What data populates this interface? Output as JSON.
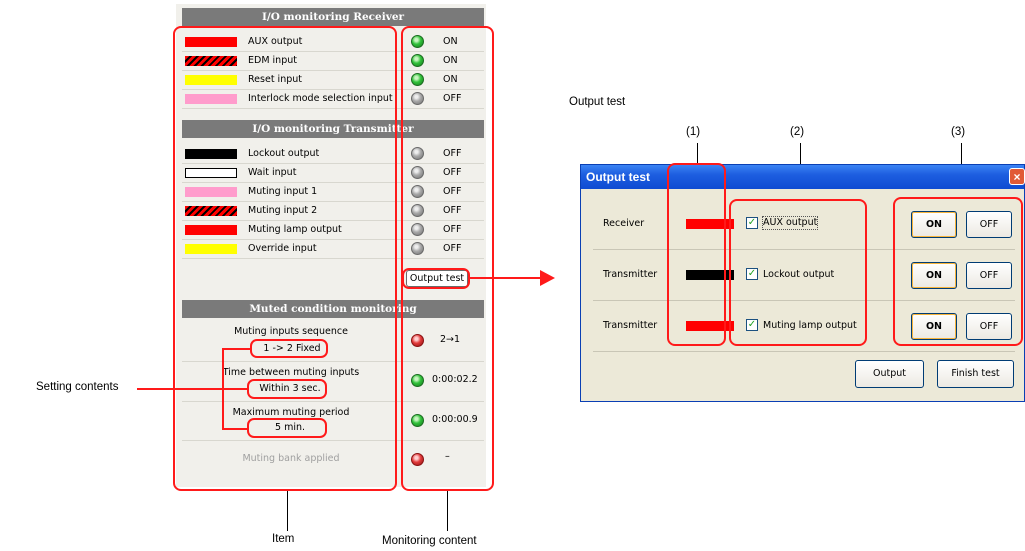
{
  "annotations": {
    "setting_contents": "Setting contents",
    "item": "Item",
    "monitoring_content": "Monitoring content",
    "output_test_caption": "Output test",
    "col_marker_1": "(1)",
    "col_marker_2": "(2)",
    "col_marker_3": "(3)"
  },
  "receiver": {
    "title": "I/O monitoring Receiver",
    "rows": [
      {
        "swatch": "red",
        "label": "AUX output",
        "led": "green",
        "state": "ON"
      },
      {
        "swatch": "red-black-hatch",
        "label": "EDM input",
        "led": "green",
        "state": "ON"
      },
      {
        "swatch": "yellow",
        "label": "Reset input",
        "led": "green",
        "state": "ON"
      },
      {
        "swatch": "pink",
        "label": "Interlock mode selection input",
        "led": "gray",
        "state": "OFF"
      }
    ]
  },
  "transmitter": {
    "title": "I/O monitoring Transmitter",
    "rows": [
      {
        "swatch": "black",
        "label": "Lockout output",
        "led": "gray",
        "state": "OFF"
      },
      {
        "swatch": "white",
        "label": "Wait input",
        "led": "gray",
        "state": "OFF"
      },
      {
        "swatch": "pink",
        "label": "Muting input 1",
        "led": "gray",
        "state": "OFF"
      },
      {
        "swatch": "red-black-hatch",
        "label": "Muting input 2",
        "led": "gray",
        "state": "OFF"
      },
      {
        "swatch": "red",
        "label": "Muting lamp output",
        "led": "gray",
        "state": "OFF"
      },
      {
        "swatch": "yellow",
        "label": "Override input",
        "led": "gray",
        "state": "OFF"
      }
    ],
    "output_test_button": "Output test"
  },
  "muted": {
    "title": "Muted condition monitoring",
    "rows": [
      {
        "label": "Muting inputs sequence",
        "setting": "1 -> 2 Fixed",
        "led": "red",
        "value": "2→1"
      },
      {
        "label": "Time between muting inputs",
        "setting": "Within 3 sec.",
        "led": "green",
        "value": "0:00:02.2"
      },
      {
        "label": "Maximum muting period",
        "setting": "5 min.",
        "led": "green",
        "value": "0:00:00.9"
      },
      {
        "label": "Muting bank applied",
        "setting": "",
        "led": "red",
        "value": "–"
      }
    ]
  },
  "dialog": {
    "title": "Output test",
    "close_glyph": "×",
    "rows": [
      {
        "label": "Receiver",
        "swatch": "red",
        "checked": true,
        "check_label": "AUX output",
        "on": "ON",
        "off": "OFF"
      },
      {
        "label": "Transmitter",
        "swatch": "black",
        "checked": true,
        "check_label": "Lockout output",
        "on": "ON",
        "off": "OFF"
      },
      {
        "label": "Transmitter",
        "swatch": "red",
        "checked": true,
        "check_label": "Muting lamp output",
        "on": "ON",
        "off": "OFF"
      }
    ],
    "output_button": "Output",
    "finish_button": "Finish test",
    "check_glyph": "✓"
  },
  "colors": {
    "callout_red": "#ff1a1a",
    "section_header": "#7a7a7a",
    "titlebar_blue": "#1d5ee0",
    "dialog_face": "#ece9d8"
  }
}
